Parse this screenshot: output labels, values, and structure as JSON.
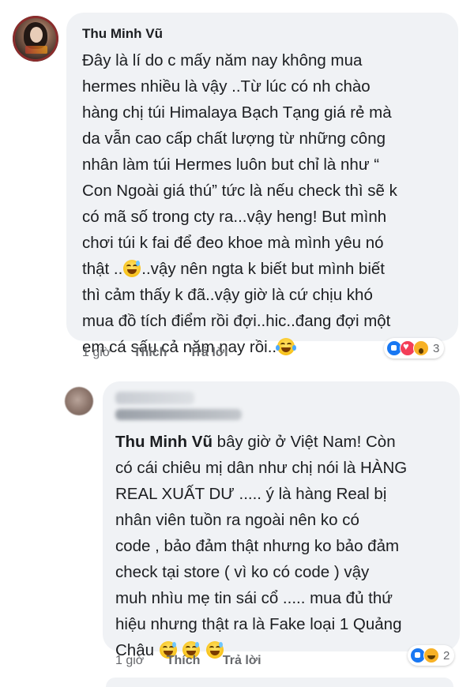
{
  "comment": {
    "author": "Thu Minh Vũ",
    "lines": [
      "Đây là lí do c mấy năm nay không mua",
      "hermes nhiều là vậy ..Từ lúc có nh chào",
      "hàng chị túi Himalaya Bạch Tạng giá rẻ mà",
      "da vẫn cao cấp chất lượng từ những công",
      "nhân làm túi Hermes luôn but chỉ là như “",
      "Con Ngoài giá thú” tức là nếu check thì sẽ k",
      "có mã số trong cty ra...vậy heng! But mình",
      "chơi túi k fai để đeo khoe mà mình yêu nó",
      "thật ..",
      "..vậy nên ngta k biết but mình biết",
      "thì cảm thấy k đã..vậy giờ là cứ chịu khó",
      "mua đồ tích điểm rồi đợi..hic..đang đợi một",
      "em cá sấu cả năm nay rồi.."
    ],
    "time": "1 giờ",
    "like_label": "Thích",
    "reply_label": "Trả lời",
    "reaction_count": "3",
    "reactions": [
      "like-icon",
      "love-icon",
      "wow-icon"
    ]
  },
  "reply": {
    "tagged_name": "Thu Minh Vũ",
    "first_line_rest": " bây giờ ở Việt Nam! Còn",
    "lines": [
      "có cái chiêu mị dân như chị nói là HÀNG",
      "REAL XUẤT DƯ ..... ý là hàng Real bị",
      "nhân viên tuồn ra ngoài nên ko có",
      "code , bảo đảm thật nhưng ko bảo đảm",
      "check tại store ( vì ko có code ) vậy",
      "muh nhìu mẹ tin sái cổ ..... mua đủ thứ",
      "hiệu nhưng thật ra là Fake loại 1 Quảng",
      "Châu"
    ],
    "time": "1 giờ",
    "like_label": "Thích",
    "reply_label": "Trả lời",
    "reaction_count": "2",
    "reactions": [
      "like-icon",
      "haha-icon"
    ]
  }
}
